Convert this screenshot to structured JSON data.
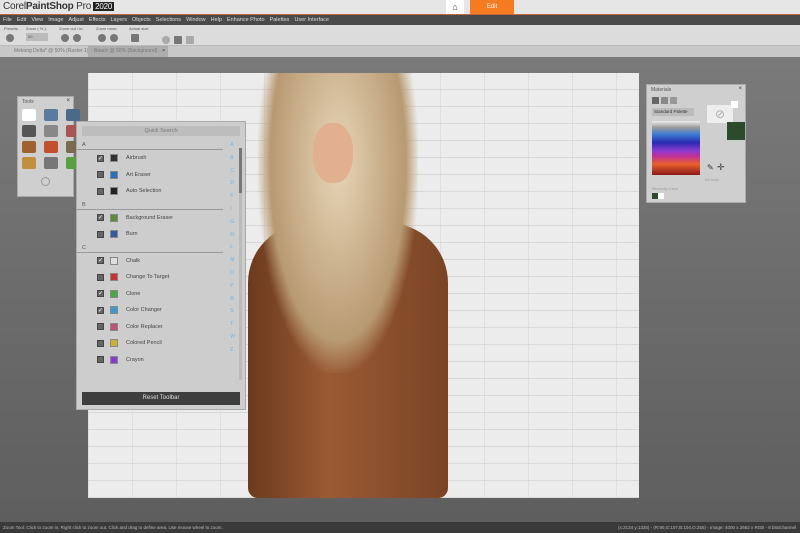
{
  "app": {
    "brand": "Corel",
    "product": "PaintShop",
    "pro": "Pro",
    "year": "2020",
    "home_icon": "home-icon",
    "edit_tab": "Edit"
  },
  "menu": [
    "File",
    "Edit",
    "View",
    "Image",
    "Adjust",
    "Effects",
    "Layers",
    "Objects",
    "Selections",
    "Window",
    "Help",
    "Enhance Photo",
    "Palettes",
    "User Interface"
  ],
  "toolbar": {
    "presets": "Presets:",
    "zoom_pct": "Zoom ( % ):",
    "zoom_value": "50",
    "zoom_inout": "Zoom out / in:",
    "zoom_more": "Zoom more:",
    "actual_size": "Actual size:"
  },
  "doc_tabs": [
    {
      "label": "Mekong Delta* @ 50% (Raster 1)"
    },
    {
      "label": "Beach @ 50% (Background)"
    }
  ],
  "tools_panel": {
    "title": "Tools"
  },
  "quick_search": {
    "title": "Quick Search",
    "sections": [
      {
        "letter": "A",
        "items": [
          {
            "label": "Airbrush",
            "checked": true
          },
          {
            "label": "Art Eraser",
            "checked": false
          },
          {
            "label": "Auto Selection",
            "checked": false
          }
        ]
      },
      {
        "letter": "B",
        "items": [
          {
            "label": "Background Eraser",
            "checked": true
          },
          {
            "label": "Burn",
            "checked": false
          }
        ]
      },
      {
        "letter": "C",
        "items": [
          {
            "label": "Chalk",
            "checked": true
          },
          {
            "label": "Change To Target",
            "checked": false
          },
          {
            "label": "Clone",
            "checked": true
          },
          {
            "label": "Color Changer",
            "checked": true
          },
          {
            "label": "Color Replacer",
            "checked": false
          },
          {
            "label": "Colored Pencil",
            "checked": false
          },
          {
            "label": "Crayon",
            "checked": false
          }
        ]
      }
    ],
    "alphabet": [
      "A",
      "B",
      "C",
      "D",
      "F",
      "I",
      "G",
      "H",
      "L",
      "M",
      "O",
      "P",
      "R",
      "S",
      "T",
      "W",
      "Z"
    ],
    "reset_label": "Reset Toolbar"
  },
  "materials": {
    "title": "Materials",
    "palette": "Standard Palette",
    "all_tools": "All tools",
    "recent": "Recently Used",
    "foreground": "#2c4a2c",
    "background": "#ffffff"
  },
  "status": {
    "left": "Zoom Tool: Click to zoom in. Right click to zoom out. Click and drag to define area. Use mouse wheel to zoom.",
    "right": "(x:2134 y:1325) - (R:90,G:107,B:104,O:255) - Image: 4000 x 2662 x RGB - 8 bits/channel"
  }
}
